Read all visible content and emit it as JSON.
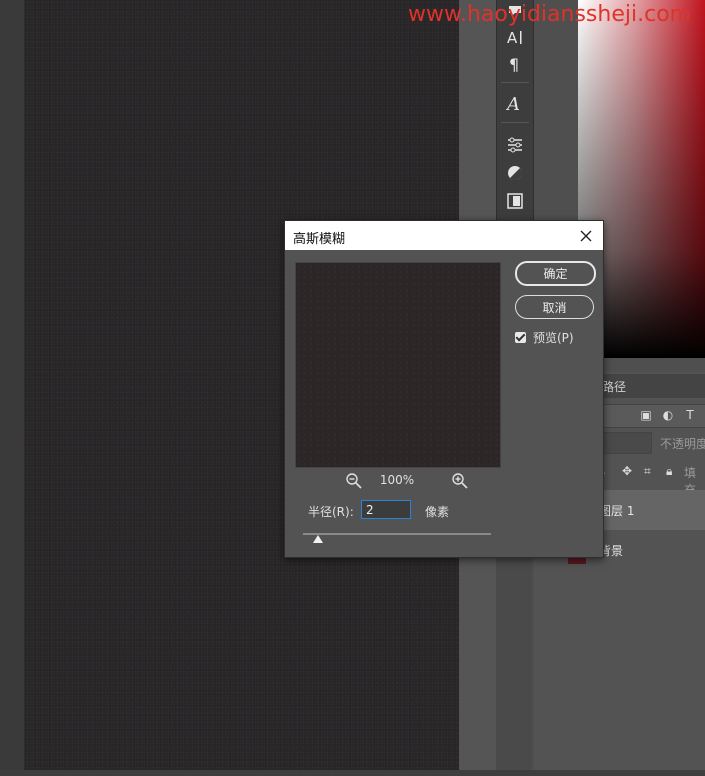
{
  "watermark": {
    "text": "www.haoyidianssheji.com"
  },
  "toolbar": {
    "icons": [
      "chat-icon",
      "character-text-icon",
      "paragraph-icon",
      "glyphs-icon",
      "adjustments-icon",
      "styles-icon",
      "library-icon"
    ]
  },
  "panel": {
    "tab_label": "路径",
    "opacity_label": "不透明度",
    "fill_label": "填充",
    "layers": [
      {
        "name": "图层 1",
        "selected": true
      },
      {
        "name": "背景",
        "selected": false
      }
    ]
  },
  "dialog": {
    "title": "高斯模糊",
    "ok_label": "确定",
    "cancel_label": "取消",
    "preview_label": "预览(P)",
    "preview_checked": true,
    "zoom_level": "100%",
    "radius_label": "半径(R):",
    "radius_value": "2",
    "radius_unit": "像素",
    "slider_level": 0.08
  },
  "colors": {
    "dialog_bg": "#535353",
    "canvas_bg": "#242424",
    "watermark": "#e0322a",
    "input_focus": "#2d82d6"
  }
}
